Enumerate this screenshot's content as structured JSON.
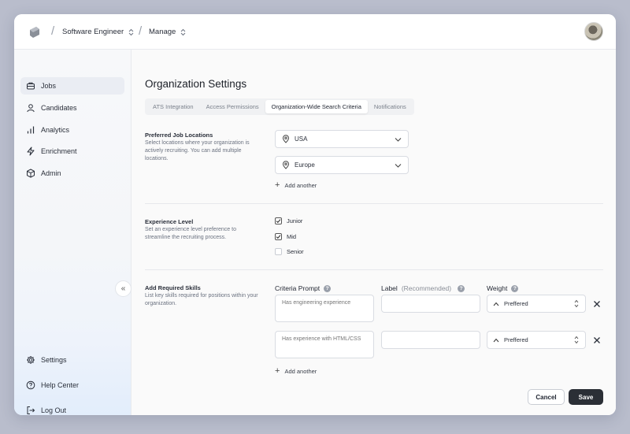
{
  "breadcrumb": {
    "project": "Software Engineer",
    "section": "Manage"
  },
  "sidebar": {
    "items": [
      {
        "label": "Jobs",
        "icon": "briefcase-icon"
      },
      {
        "label": "Candidates",
        "icon": "user-icon"
      },
      {
        "label": "Analytics",
        "icon": "bar-chart-icon"
      },
      {
        "label": "Enrichment",
        "icon": "lightning-icon"
      },
      {
        "label": "Admin",
        "icon": "box-icon"
      }
    ],
    "bottom_items": [
      {
        "label": "Settings",
        "icon": "gear-icon"
      },
      {
        "label": "Help Center",
        "icon": "help-circle-icon"
      },
      {
        "label": "Log Out",
        "icon": "logout-icon"
      }
    ],
    "collapse_glyph": "«"
  },
  "page": {
    "title": "Organization Settings",
    "tabs": [
      "ATS Integration",
      "Access Permissions",
      "Organization-Wide Search Criteria",
      "Notifications"
    ],
    "active_tab": "Organization-Wide Search Criteria"
  },
  "locations": {
    "title": "Preferred Job Locations",
    "description": "Select locations where your organization is actively recruiting. You can add multiple locations.",
    "values": [
      "USA",
      "Europe"
    ],
    "add_label": "Add another"
  },
  "experience": {
    "title": "Experience Level",
    "description": "Set an experience level preference to streamline the recruiting process.",
    "options": [
      {
        "label": "Junior",
        "checked": true
      },
      {
        "label": "Mid",
        "checked": true
      },
      {
        "label": "Senior",
        "checked": false
      }
    ]
  },
  "skills": {
    "title": "Add Required Skills",
    "description": "List key skills required for positions within your organization.",
    "col_prompt": "Criteria Prompt",
    "col_label": "Label",
    "col_label_hint": "(Recommended)",
    "col_weight": "Weight",
    "rows": [
      {
        "prompt_placeholder": "Has engineering experience",
        "label_value": "",
        "weight": "Preffered"
      },
      {
        "prompt_placeholder": "Has experience with HTML/CSS",
        "label_value": "",
        "weight": "Preffered"
      }
    ],
    "add_label": "Add another"
  },
  "actions": {
    "cancel": "Cancel",
    "save": "Save"
  }
}
